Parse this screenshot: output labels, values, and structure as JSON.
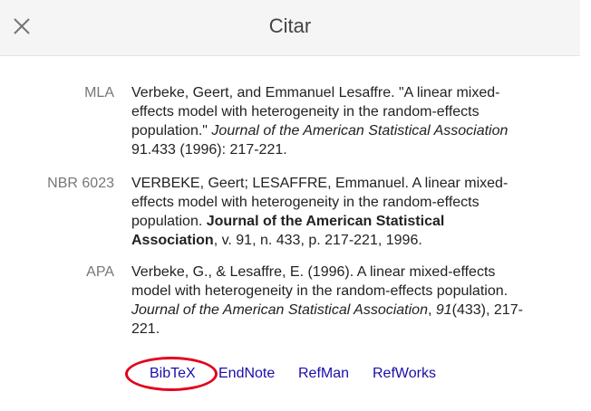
{
  "dialog": {
    "title": "Citar",
    "close_icon": "close-icon"
  },
  "citations": [
    {
      "label": "MLA",
      "parts": [
        {
          "text": "Verbeke, Geert, and Emmanuel Lesaffre. \"A linear mixed-effects model with heterogeneity in the random-effects population.\" ",
          "style": "normal"
        },
        {
          "text": "Journal of the American Statistical Association",
          "style": "italic"
        },
        {
          "text": " 91.433 (1996): 217-221.",
          "style": "normal"
        }
      ]
    },
    {
      "label": "NBR 6023",
      "parts": [
        {
          "text": "VERBEKE, Geert; LESAFFRE, Emmanuel. A linear mixed-effects model with heterogeneity in the random-effects population. ",
          "style": "normal"
        },
        {
          "text": "Journal of the American Statistical Association",
          "style": "bold"
        },
        {
          "text": ", v. 91, n. 433, p. 217-221, 1996.",
          "style": "normal"
        }
      ]
    },
    {
      "label": "APA",
      "parts": [
        {
          "text": "Verbeke, G., & Lesaffre, E. (1996). A linear mixed-effects model with heterogeneity in the random-effects population. ",
          "style": "normal"
        },
        {
          "text": "Journal of the American Statistical Association",
          "style": "italic"
        },
        {
          "text": ", ",
          "style": "normal"
        },
        {
          "text": "91",
          "style": "italic"
        },
        {
          "text": "(433), 217-221.",
          "style": "normal"
        }
      ]
    }
  ],
  "export_links": {
    "bibtex": "BibTeX",
    "endnote": "EndNote",
    "refman": "RefMan",
    "refworks": "RefWorks"
  },
  "colors": {
    "link": "#1a0dab",
    "highlight_circle": "#e3001b",
    "header_bg": "#f5f5f5"
  }
}
